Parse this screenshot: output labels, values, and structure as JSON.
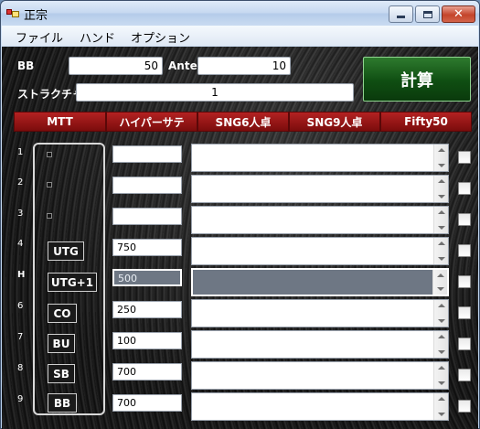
{
  "window": {
    "title": "正宗"
  },
  "menu": [
    "ファイル",
    "ハンド",
    "オプション"
  ],
  "inputs": {
    "bb_label": "BB",
    "bb_value": "50",
    "ante_label": "Ante",
    "ante_value": "10",
    "structure_label": "ストラクチャ",
    "structure_value": "1"
  },
  "calc_button": "計算",
  "tabs": [
    "MTT",
    "ハイパーサテ",
    "SNG6人卓",
    "SNG9人卓",
    "Fifty50"
  ],
  "rows": [
    {
      "num": "1",
      "position": "",
      "stack": ""
    },
    {
      "num": "2",
      "position": "",
      "stack": ""
    },
    {
      "num": "3",
      "position": "",
      "stack": ""
    },
    {
      "num": "4",
      "position": "UTG",
      "stack": "750"
    },
    {
      "num": "H",
      "position": "UTG+1",
      "stack": "500"
    },
    {
      "num": "6",
      "position": "CO",
      "stack": "250"
    },
    {
      "num": "7",
      "position": "BU",
      "stack": "100"
    },
    {
      "num": "8",
      "position": "SB",
      "stack": "700"
    },
    {
      "num": "9",
      "position": "BB",
      "stack": "700"
    }
  ]
}
